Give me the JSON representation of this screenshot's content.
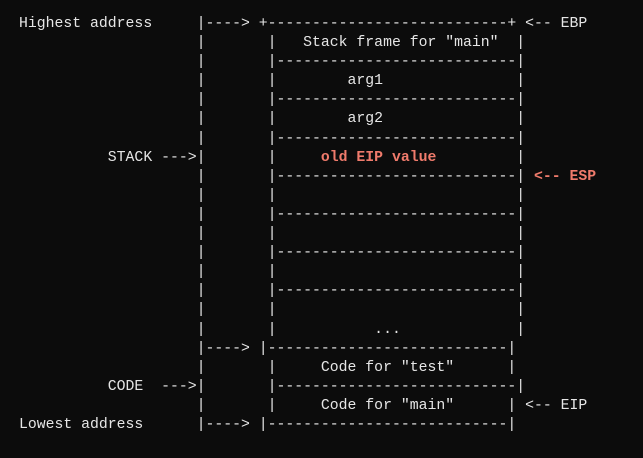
{
  "colors": {
    "background": "#0c0c0c",
    "text": "#e6e6e6",
    "highlight": "#f07b6c"
  },
  "lines": [
    [
      {
        "t": "Highest address     |----> +---------------------------+ <-- EBP"
      }
    ],
    [
      {
        "t": "                    |       |   Stack frame for \"main\"  |"
      }
    ],
    [
      {
        "t": "                    |       |---------------------------|"
      }
    ],
    [
      {
        "t": "                    |       |        arg1               |"
      }
    ],
    [
      {
        "t": "                    |       |---------------------------|"
      }
    ],
    [
      {
        "t": "                    |       |        arg2               |"
      }
    ],
    [
      {
        "t": "                    |       |---------------------------|"
      }
    ],
    [
      {
        "t": "          STACK --->|       |     "
      },
      {
        "t": "old EIP value",
        "hl": true
      },
      {
        "t": "         |"
      }
    ],
    [
      {
        "t": "                    |       |---------------------------| "
      },
      {
        "t": "<-- ESP",
        "hl": true
      }
    ],
    [
      {
        "t": "                    |       |                           |"
      }
    ],
    [
      {
        "t": "                    |       |---------------------------|"
      }
    ],
    [
      {
        "t": "                    |       |                           |"
      }
    ],
    [
      {
        "t": "                    |       |---------------------------|"
      }
    ],
    [
      {
        "t": "                    |       |                           |"
      }
    ],
    [
      {
        "t": "                    |       |---------------------------|"
      }
    ],
    [
      {
        "t": "                    |       |                           |"
      }
    ],
    [
      {
        "t": "                    |       |           ...             |"
      }
    ],
    [
      {
        "t": "                    |----> |---------------------------|"
      }
    ],
    [
      {
        "t": "                    |       |     Code for \"test\"      |"
      }
    ],
    [
      {
        "t": "          CODE  --->|       |---------------------------|"
      }
    ],
    [
      {
        "t": "                    |       |     Code for \"main\"      | <-- EIP"
      }
    ],
    [
      {
        "t": "Lowest address      |----> |---------------------------|"
      }
    ]
  ]
}
